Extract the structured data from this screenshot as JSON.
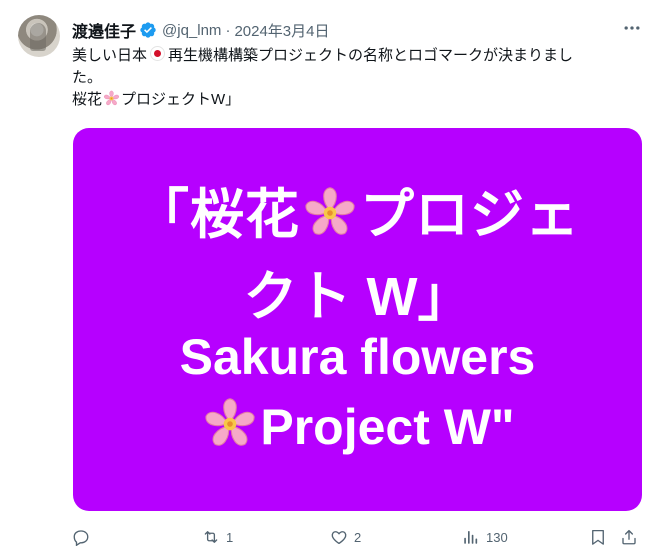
{
  "tweet": {
    "display_name": "渡邉佳子",
    "handle": "@jq_lnm",
    "separator": "·",
    "date": "2024年3月4日",
    "text_line1_a": "美しい日本",
    "text_line1_b": "再生機構構築プロジェクトの名称とロゴマークが決まりまし",
    "text_line2": "た。",
    "text_line3_a": "桜花",
    "text_line3_b": "プロジェクトW」"
  },
  "card": {
    "line1_a": "「桜花",
    "line1_b": "プロジェ",
    "line2": "クト W」",
    "line3": "Sakura flowers",
    "line4_b": "Project W\"",
    "background": "#b600ff"
  },
  "actions": {
    "reply_count": "",
    "retweet_count": "1",
    "like_count": "2",
    "views_count": "130"
  },
  "icons": [
    "verified-badge-icon",
    "more-icon",
    "japan-flag-icon",
    "sakura-icon",
    "reply-icon",
    "retweet-icon",
    "like-icon",
    "views-icon",
    "bookmark-icon",
    "share-icon"
  ],
  "colors": {
    "verified": "#1d9bf0",
    "secondary_text": "#536471",
    "primary_text": "#0f1419",
    "flag_red": "#d3102a",
    "card_purple": "#b600ff"
  }
}
